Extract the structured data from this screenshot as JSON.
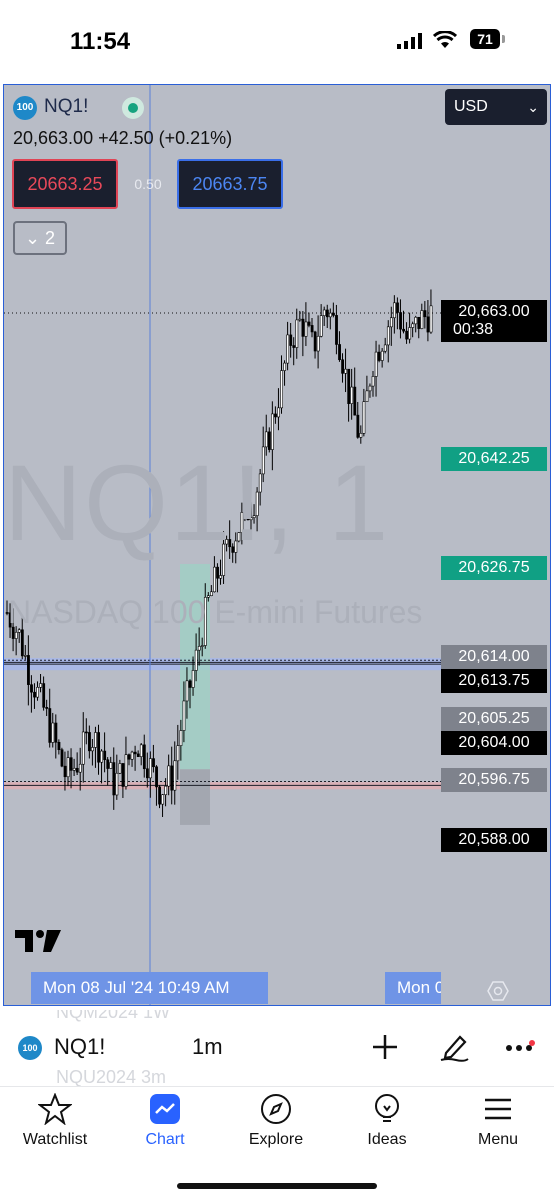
{
  "status_bar": {
    "time": "11:54",
    "battery": "71"
  },
  "header": {
    "symbol_badge": "100",
    "symbol": "NQ1!",
    "quote": "20,663.00  +42.50 (+0.21%)",
    "bid": "20663.25",
    "spread": "0.50",
    "ask": "20663.75",
    "collapse_count": "2",
    "currency": "USD"
  },
  "watermark": {
    "line1": "NQ1!, 1",
    "line2": "NASDAQ 100 E-mini Futures"
  },
  "price_labels": [
    {
      "text": "20,663.00",
      "style": "black"
    },
    {
      "text": "20,642.25",
      "style": "green"
    },
    {
      "text": "20,626.75",
      "style": "green"
    },
    {
      "text": "20,614.00",
      "style": "grey"
    },
    {
      "text": "20,613.75",
      "style": "black"
    },
    {
      "text": "20,605.25",
      "style": "grey"
    },
    {
      "text": "20,604.00",
      "style": "black"
    },
    {
      "text": "20,596.75",
      "style": "grey"
    },
    {
      "text": "20,588.00",
      "style": "black"
    }
  ],
  "countdown": "00:38",
  "crosshair_time": "Mon 08 Jul '24    10:49 AM",
  "time_label_right": "Mon 0",
  "colors": {
    "chart_bg": "#b8bcc6",
    "accent": "#2962ff",
    "green_label": "#10a084",
    "bid_red": "#e8495a",
    "ask_blue": "#4c86f2"
  },
  "toolbar": {
    "symbol_badge": "100",
    "symbol": "NQ1!",
    "interval": "1m",
    "ghost_above": "NQM2024    1W",
    "ghost_below": "NQU2024    3m",
    "icons": [
      "plus-icon",
      "pen-icon",
      "more-icon"
    ]
  },
  "tabs": [
    {
      "label": "Watchlist",
      "icon": "star-icon",
      "active": false
    },
    {
      "label": "Chart",
      "icon": "chart-icon",
      "active": true
    },
    {
      "label": "Explore",
      "icon": "compass-icon",
      "active": false
    },
    {
      "label": "Ideas",
      "icon": "bulb-icon",
      "active": false
    },
    {
      "label": "Menu",
      "icon": "menu-icon",
      "active": false
    }
  ],
  "chart_data": {
    "type": "candlestick",
    "instrument": "NQ1!",
    "interval": "1",
    "y_axis_labels": [
      20663.0,
      20642.25,
      20626.75,
      20614.0,
      20613.75,
      20605.25,
      20604.0,
      20596.75,
      20588.0
    ],
    "last_price": 20663.0,
    "horizontal_levels": [
      20614.0,
      20613.75,
      20596.75
    ],
    "crosshair_time": "Mon 08 Jul '24 10:49 AM",
    "close_path": [
      20621,
      20618,
      20612,
      20608,
      20603,
      20598,
      20600,
      20604,
      20602,
      20597,
      20599,
      20603,
      20600,
      20596,
      20598,
      20607,
      20614,
      20622,
      20627,
      20631,
      20634,
      20637,
      20644,
      20651,
      20659,
      20662,
      20658,
      20664,
      20661,
      20652,
      20645,
      20656,
      20660,
      20664,
      20659,
      20662,
      20663
    ]
  }
}
